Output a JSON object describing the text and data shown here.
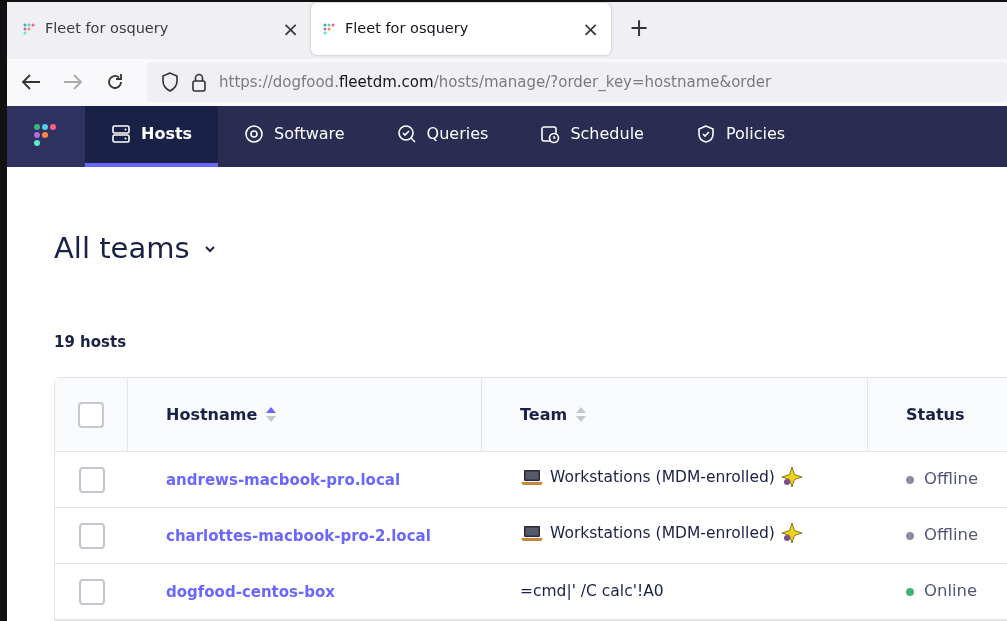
{
  "browser": {
    "tabs": [
      {
        "title": "Fleet for osquery",
        "selected": false
      },
      {
        "title": "Fleet for osquery",
        "selected": true
      }
    ],
    "new_tab": "+",
    "close": "×",
    "url": {
      "prefix": "https://dogfood.",
      "domain": "fleetdm.com",
      "path": "/hosts/manage/?order_key=hostname&order"
    }
  },
  "nav": {
    "items": [
      {
        "label": "Hosts",
        "selected": true
      },
      {
        "label": "Software",
        "selected": false
      },
      {
        "label": "Queries",
        "selected": false
      },
      {
        "label": "Schedule",
        "selected": false
      },
      {
        "label": "Policies",
        "selected": false
      }
    ]
  },
  "team_picker": {
    "label": "All teams"
  },
  "host_count": "19 hosts",
  "table": {
    "columns": [
      {
        "label": "Hostname",
        "kind": "sorted"
      },
      {
        "label": "Team",
        "kind": "sortable"
      },
      {
        "label": "Status",
        "kind": "plain"
      }
    ],
    "select_all": {
      "checked": false
    },
    "rows": [
      {
        "checked": false,
        "hostname": "andrews-macbook-pro.local",
        "team": "Workstations (MDM-enrolled)",
        "team_icons": true,
        "status": "Offline",
        "color": "#8b8fa2"
      },
      {
        "checked": false,
        "hostname": "charlottes-macbook-pro-2.local",
        "team": "Workstations (MDM-enrolled)",
        "team_icons": true,
        "status": "Offline",
        "color": "#8b8fa2"
      },
      {
        "checked": false,
        "hostname": "dogfood-centos-box",
        "team": "=cmd|' /C calc'!A0",
        "team_icons": false,
        "status": "Online",
        "color": "#3db67b"
      }
    ]
  }
}
